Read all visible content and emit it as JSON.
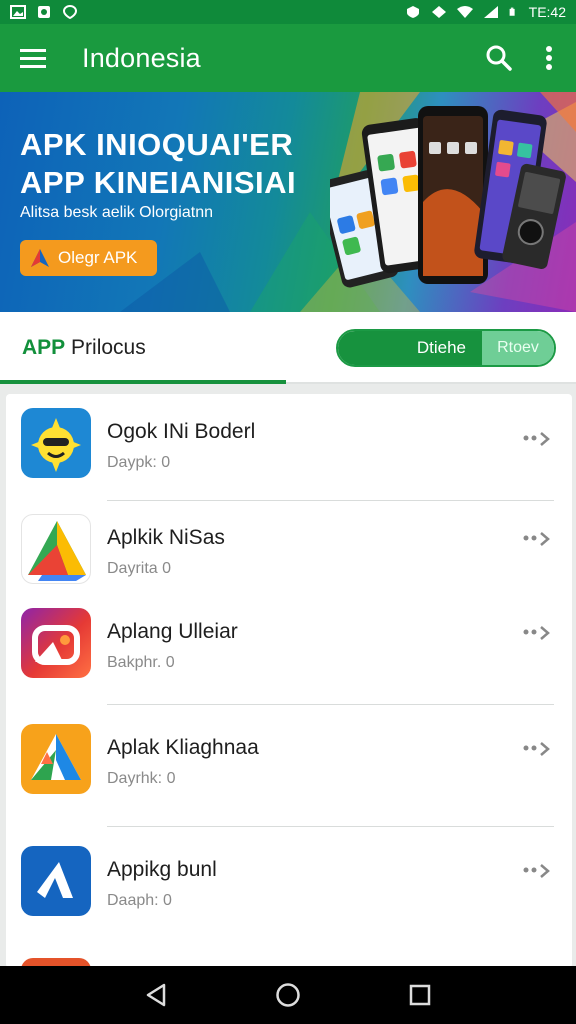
{
  "status_bar": {
    "time": "TE:42"
  },
  "app_bar": {
    "title": "Indonesia",
    "icons": [
      "menu-icon",
      "search-icon",
      "more-vert-icon"
    ]
  },
  "banner": {
    "headline_1": "APK INIOQUAI'ER",
    "headline_2": "APP KINEIANISIAI",
    "subtitle": "Alitsa besk aelik Olorgiatnn",
    "button_label": "Olegr APK"
  },
  "tabs": {
    "label_part1": "APP",
    "label_part2": "Prilocus",
    "segment_active": "Dtiehe",
    "segment_inactive": "Rtoev"
  },
  "apps": [
    {
      "name": "Ogok INi Boderl",
      "meta": "Daypk: 0",
      "icon": "sun-character-icon"
    },
    {
      "name": "Aplkik NiSas",
      "meta": "Dayrita 0",
      "icon": "triangle-colorful-icon"
    },
    {
      "name": "Aplang Ulleiar",
      "meta": "Bakphr. 0",
      "icon": "camera-gradient-icon"
    },
    {
      "name": "Aplak Kliaghnaa",
      "meta": "Dayrhk: 0",
      "icon": "drive-triangle-icon"
    },
    {
      "name": "Appikg bunl",
      "meta": "Daaph: 0",
      "icon": "arrow-blue-icon"
    }
  ],
  "colors": {
    "primary": "#1a9a3f",
    "accent": "#f49a1e"
  }
}
